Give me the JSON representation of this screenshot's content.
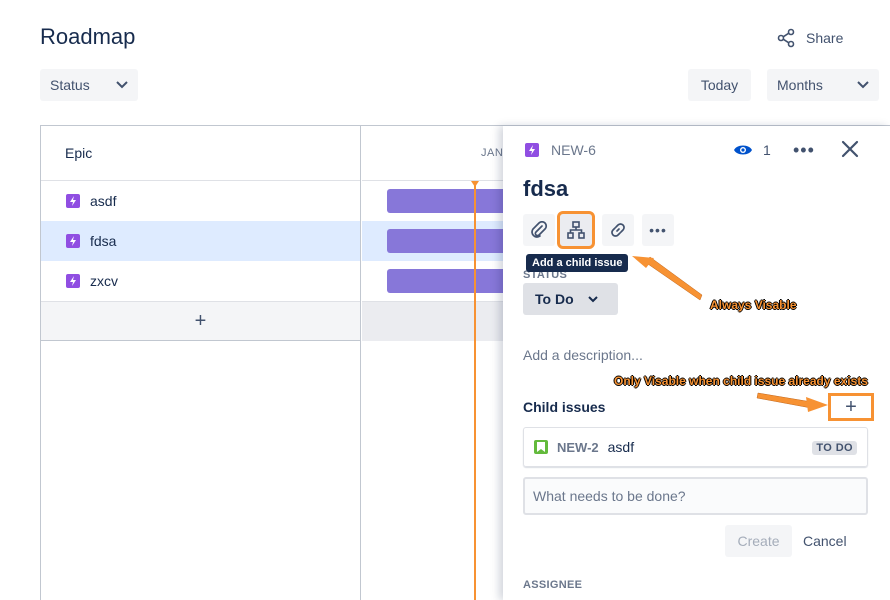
{
  "page": {
    "title": "Roadmap",
    "share_label": "Share",
    "status_filter": "Status",
    "today_label": "Today",
    "zoom_select": "Months"
  },
  "roadmap": {
    "column_header": "Epic",
    "timeline_month": "JAN",
    "epics": [
      {
        "name": "asdf",
        "selected": false
      },
      {
        "name": "fdsa",
        "selected": true
      },
      {
        "name": "zxcv",
        "selected": false
      }
    ],
    "add_label": "+"
  },
  "panel": {
    "issue_key": "NEW-6",
    "watchers": "1",
    "title": "fdsa",
    "tooltip": "Add a child issue",
    "status_label": "STATUS",
    "status_value": "To Do",
    "description_placeholder": "Add a description...",
    "child_issues_label": "Child issues",
    "child_add_label": "+",
    "child_issues": [
      {
        "key": "NEW-2",
        "summary": "asdf",
        "status": "TO DO"
      }
    ],
    "new_child_placeholder": "What needs to be done?",
    "create_label": "Create",
    "cancel_label": "Cancel",
    "assignee_label": "ASSIGNEE"
  },
  "annotations": {
    "always_visible": "Always Visable",
    "only_visible": "Only Visable when child issue already exists"
  },
  "colors": {
    "accent_orange": "#f79233",
    "epic_purple": "#904ee2",
    "bar_purple": "#8777d9",
    "story_green": "#63ba3c",
    "selected_row": "#deebff"
  }
}
